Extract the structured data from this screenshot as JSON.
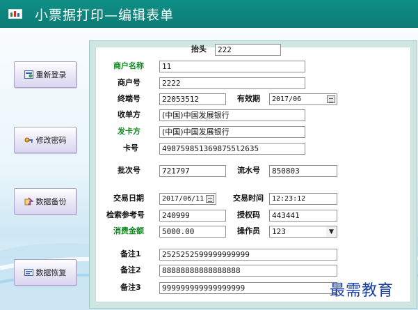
{
  "window": {
    "title": "小票据打印—编辑表单",
    "icon": "window-icon"
  },
  "sidebar": {
    "buttons": [
      {
        "label": "重新登录",
        "icon": "relogin-icon"
      },
      {
        "label": "修改密码",
        "icon": "key-icon"
      },
      {
        "label": "数据备份",
        "icon": "backup-icon"
      },
      {
        "label": "数据恢复",
        "icon": "restore-icon"
      }
    ]
  },
  "form": {
    "header": {
      "label": "抬头",
      "value": "222"
    },
    "merchant_name": {
      "label": "商户名称",
      "value": "11"
    },
    "merchant_no": {
      "label": "商户号",
      "value": "2222"
    },
    "terminal_no": {
      "label": "终端号",
      "value": "22053512"
    },
    "expiry": {
      "label": "有效期",
      "value": "2017/06"
    },
    "acquirer": {
      "label": "收单方",
      "value": "(中国)中国发展银行"
    },
    "issuer": {
      "label": "发卡方",
      "value": "(中国)中国发展银行"
    },
    "card_no": {
      "label": "卡号",
      "value": "4987598513698755l2635"
    },
    "batch_no": {
      "label": "批次号",
      "value": "721797"
    },
    "serial_no": {
      "label": "流水号",
      "value": "850803"
    },
    "trade_date": {
      "label": "交易日期",
      "value": "2017/06/11"
    },
    "trade_time": {
      "label": "交易时间",
      "value": "12:23:12"
    },
    "ref_no": {
      "label": "检索参考号",
      "value": "240999"
    },
    "auth_code": {
      "label": "授权码",
      "value": "443441"
    },
    "amount": {
      "label": "消费金额",
      "value": "5000.00"
    },
    "operator": {
      "label": "操作员",
      "value": "123"
    },
    "note1": {
      "label": "备注1",
      "value": "2525252599999999999"
    },
    "note2": {
      "label": "备注2",
      "value": "88888888888888888"
    },
    "note3": {
      "label": "备注3",
      "value": "999999999999999999"
    }
  },
  "watermark": "最需教育",
  "colors": {
    "titlebar": "#0f8f86",
    "green_label": "#118a22",
    "watermark": "#1a3ea8"
  }
}
